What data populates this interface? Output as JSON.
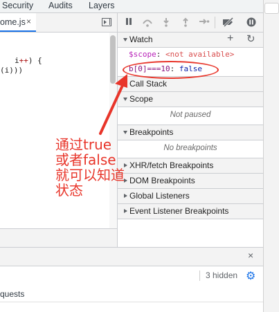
{
  "top_tabs": [
    "Security",
    "Audits",
    "Layers"
  ],
  "source": {
    "file_tab_label": "ome.js",
    "file_tab_close": "×",
    "code_lines": [
      {
        "text": "i",
        "op": "++",
        "rest": ") {"
      },
      {
        "text": "(i)))",
        "op": "",
        "rest": ""
      }
    ]
  },
  "debugger_toolbar": {
    "pause_icon": "pause-icon",
    "step_over_icon": "step-over-icon",
    "step_into_icon": "step-into-icon",
    "step_out_icon": "step-out-icon",
    "step_icon": "step-icon",
    "deactivate_breakpoints_icon": "deactivate-breakpoints-icon",
    "pause_on_exceptions_icon": "pause-on-exceptions-icon"
  },
  "sections": {
    "watch": {
      "title": "Watch",
      "add": "+",
      "refresh": "↻",
      "expressions": [
        {
          "name": "$scope",
          "sep": ": ",
          "value": "<not available>"
        },
        {
          "name": "b[0]===10",
          "sep": ": ",
          "value": "false"
        }
      ]
    },
    "call_stack": {
      "title": "Call Stack"
    },
    "scope": {
      "title": "Scope",
      "empty": "Not paused"
    },
    "breakpoints": {
      "title": "Breakpoints",
      "empty": "No breakpoints"
    },
    "xhr": {
      "title": "XHR/fetch Breakpoints"
    },
    "dom": {
      "title": "DOM Breakpoints"
    },
    "global": {
      "title": "Global Listeners"
    },
    "event": {
      "title": "Event Listener Breakpoints"
    }
  },
  "drawer": {
    "close": "×",
    "hidden_count": "3 hidden",
    "settings_icon": "gear-icon",
    "requests_label": "quests"
  },
  "annotation": {
    "lines": [
      "通过true",
      "或者false",
      "就可以知道",
      "状态"
    ],
    "color": "#e8352a"
  }
}
